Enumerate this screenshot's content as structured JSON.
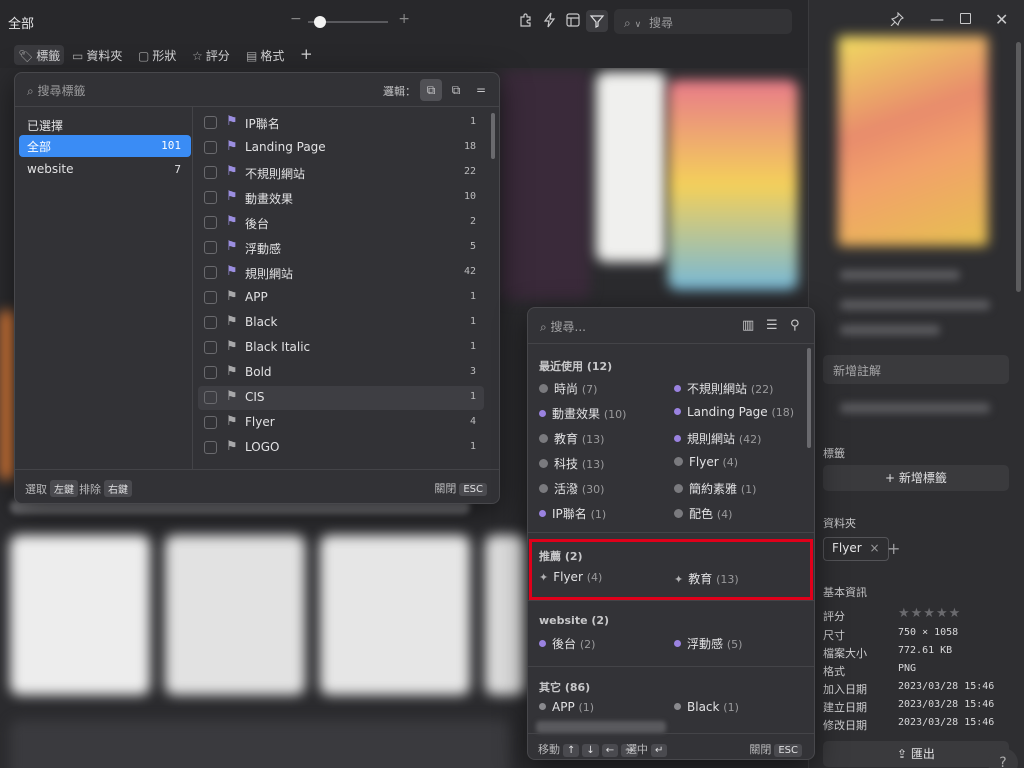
{
  "topbar": {
    "breadcrumb": "全部",
    "zoom_minus": "−",
    "zoom_plus": "+",
    "search_placeholder": "搜尋",
    "search_caret": "∨"
  },
  "filterbar": {
    "items": [
      {
        "label": "標籤",
        "icon": "bookmark-icon"
      },
      {
        "label": "資料夾",
        "icon": "folder-icon"
      },
      {
        "label": "形狀",
        "icon": "aspect-ratio-icon"
      },
      {
        "label": "評分",
        "icon": "star-icon"
      },
      {
        "label": "格式",
        "icon": "file-format-icon"
      }
    ],
    "add": "+"
  },
  "tag_popup": {
    "search_placeholder": "搜尋標籤",
    "logic_label": "邏輯：",
    "left_header": "已選擇",
    "groups": [
      {
        "label": "全部",
        "count": "101"
      },
      {
        "label": "website",
        "count": "7"
      }
    ],
    "tags": [
      {
        "label": "IP聯名",
        "count": "1",
        "color": "purple"
      },
      {
        "label": "Landing Page",
        "count": "18",
        "color": "purple"
      },
      {
        "label": "不規則網站",
        "count": "22",
        "color": "purple"
      },
      {
        "label": "動畫效果",
        "count": "10",
        "color": "purple"
      },
      {
        "label": "後台",
        "count": "2",
        "color": "purple"
      },
      {
        "label": "浮動感",
        "count": "5",
        "color": "purple"
      },
      {
        "label": "規則網站",
        "count": "42",
        "color": "purple"
      },
      {
        "label": "APP",
        "count": "1",
        "color": "gray"
      },
      {
        "label": "Black",
        "count": "1",
        "color": "gray"
      },
      {
        "label": "Black Italic",
        "count": "1",
        "color": "gray"
      },
      {
        "label": "Bold",
        "count": "3",
        "color": "gray"
      },
      {
        "label": "CIS",
        "count": "1",
        "color": "gray"
      },
      {
        "label": "Flyer",
        "count": "4",
        "color": "gray"
      },
      {
        "label": "LOGO",
        "count": "1",
        "color": "gray"
      }
    ],
    "footer": {
      "select_label": "選取",
      "select_key": "左鍵",
      "exclude_label": "排除",
      "exclude_key": "右鍵",
      "close_label": "關閉",
      "close_key": "ESC"
    }
  },
  "quick_popup": {
    "search_placeholder": "搜尋...",
    "recent_header": "最近使用 (12)",
    "recent": [
      {
        "label": "時尚",
        "count": "(7)",
        "dot": "clock"
      },
      {
        "label": "不規則網站",
        "count": "(22)",
        "dot": "purple"
      },
      {
        "label": "動畫效果",
        "count": "(10)",
        "dot": "purple"
      },
      {
        "label": "Landing Page",
        "count": "(18)",
        "dot": "purple"
      },
      {
        "label": "教育",
        "count": "(13)",
        "dot": "clock"
      },
      {
        "label": "規則網站",
        "count": "(42)",
        "dot": "purple"
      },
      {
        "label": "科技",
        "count": "(13)",
        "dot": "clock"
      },
      {
        "label": "Flyer",
        "count": "(4)",
        "dot": "clock"
      },
      {
        "label": "活潑",
        "count": "(30)",
        "dot": "clock"
      },
      {
        "label": "簡約素雅",
        "count": "(1)",
        "dot": "clock"
      },
      {
        "label": "IP聯名",
        "count": "(1)",
        "dot": "purple"
      },
      {
        "label": "配色",
        "count": "(4)",
        "dot": "clock"
      }
    ],
    "recommend_header": "推薦 (2)",
    "recommend": [
      {
        "label": "Flyer",
        "count": "(4)"
      },
      {
        "label": "教育",
        "count": "(13)"
      }
    ],
    "website_header": "website (2)",
    "website": [
      {
        "label": "後台",
        "count": "(2)"
      },
      {
        "label": "浮動感",
        "count": "(5)"
      }
    ],
    "other_header": "其它 (86)",
    "other": [
      {
        "label": "APP",
        "count": "(1)"
      },
      {
        "label": "Black",
        "count": "(1)"
      }
    ],
    "footer": {
      "move_label": "移動",
      "select_label": "選中",
      "close_label": "關閉",
      "close_key": "ESC"
    }
  },
  "right_panel": {
    "note_placeholder": "新增註解",
    "tags_label": "標籤",
    "add_tag_button": "新增標籤",
    "folder_label": "資料夾",
    "folder_chip": "Flyer",
    "basic_info_label": "基本資訊",
    "info": [
      {
        "key": "評分",
        "value": ""
      },
      {
        "key": "尺寸",
        "value": "750 × 1058"
      },
      {
        "key": "檔案大小",
        "value": "772.61 KB"
      },
      {
        "key": "格式",
        "value": "PNG"
      },
      {
        "key": "加入日期",
        "value": "2023/03/28 15:46"
      },
      {
        "key": "建立日期",
        "value": "2023/03/28 15:46"
      },
      {
        "key": "修改日期",
        "value": "2023/03/28 15:46"
      }
    ],
    "rating": 0,
    "export_button": "匯出",
    "help": "?"
  },
  "colors": {
    "accent": "#3a8cf5",
    "highlight_box": "#e0001a",
    "tag_purple": "#9a82e0"
  }
}
